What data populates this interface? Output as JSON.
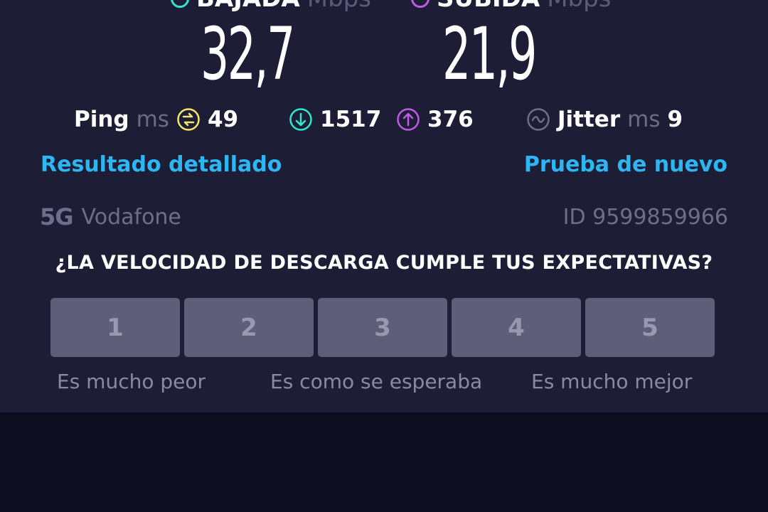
{
  "header": {
    "download_label": "BAJADA",
    "upload_label": "SUBIDA",
    "unit": "Mbps"
  },
  "speeds": {
    "download": "32,7",
    "upload": "21,9"
  },
  "stats": {
    "ping_label": "Ping",
    "ping_unit": "ms",
    "ping_value": "49",
    "download_latency": "1517",
    "upload_latency": "376",
    "jitter_label": "Jitter",
    "jitter_unit": "ms",
    "jitter_value": "9"
  },
  "links": {
    "detailed": "Resultado detallado",
    "retry": "Prueba de nuevo"
  },
  "network": {
    "generation": "5G",
    "carrier": "Vodafone",
    "result_id": "ID 9599859966"
  },
  "survey": {
    "question": "¿LA VELOCIDAD DE DESCARGA CUMPLE TUS EXPECTATIVAS?",
    "options": [
      "1",
      "2",
      "3",
      "4",
      "5"
    ],
    "label_low": "Es mucho peor",
    "label_mid": "Es como se esperaba",
    "label_high": "Es mucho mejor"
  },
  "colors": {
    "panel_bg": "#1d1d35",
    "page_bg": "#0d0d20",
    "link": "#2eb6f2",
    "download_accent": "#2ee8d0",
    "upload_accent": "#c05ae8",
    "ping_accent": "#f2e86b",
    "jitter_accent": "#6e6e8a"
  },
  "icons": {
    "download": "download-icon",
    "upload": "upload-icon",
    "ping": "ping-icon",
    "jitter": "jitter-icon"
  }
}
